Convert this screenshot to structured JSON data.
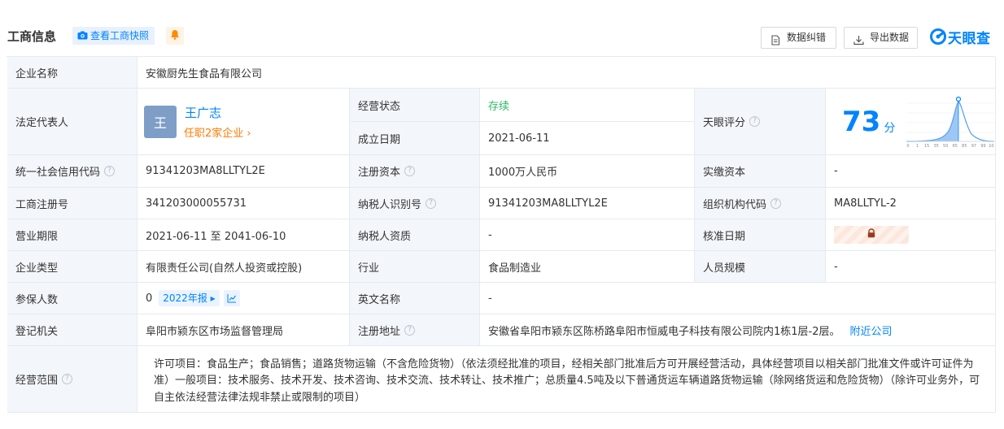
{
  "header": {
    "title": "工商信息",
    "snapshot_btn": "查看工商快照",
    "correct_btn": "数据纠错",
    "export_btn": "导出数据",
    "logo": "天眼查"
  },
  "colors": {
    "accent": "#0084ff",
    "status_green": "#2fb866",
    "orange": "#ff7a00",
    "label_bg": "#f3f6fb",
    "border": "#e4eaf2"
  },
  "fields": {
    "company_name_label": "企业名称",
    "company_name": "安徽厨先生食品有限公司",
    "legal_rep_label": "法定代表人",
    "legal_rep_avatar": "王",
    "legal_rep_name": "王广志",
    "legal_rep_sub": "任职2家企业",
    "status_label": "经营状态",
    "status": "存续",
    "established_label": "成立日期",
    "established": "2021-06-11",
    "score_label": "天眼评分",
    "score": "73",
    "score_unit": "分",
    "score_axis": [
      "0",
      "1",
      "15",
      "35",
      "50",
      "65",
      "85",
      "97",
      "99",
      "100"
    ],
    "credit_code_label": "统一社会信用代码",
    "credit_code": "91341203MA8LLTYL2E",
    "reg_capital_label": "注册资本",
    "reg_capital": "1000万人民币",
    "paid_capital_label": "实缴资本",
    "paid_capital": "-",
    "reg_no_label": "工商注册号",
    "reg_no": "341203000055731",
    "taxpayer_id_label": "纳税人识别号",
    "taxpayer_id": "91341203MA8LLTYL2E",
    "org_code_label": "组织机构代码",
    "org_code": "MA8LLTYL-2",
    "term_label": "营业期限",
    "term": "2021-06-11 至 2041-06-10",
    "taxpayer_qual_label": "纳税人资质",
    "taxpayer_qual": "-",
    "approval_date_label": "核准日期",
    "type_label": "企业类型",
    "type": "有限责任公司(自然人投资或控股)",
    "industry_label": "行业",
    "industry": "食品制造业",
    "staff_size_label": "人员规模",
    "staff_size": "-",
    "insured_label": "参保人数",
    "insured": "0",
    "insured_year": "2022年报",
    "english_name_label": "英文名称",
    "english_name": "-",
    "authority_label": "登记机关",
    "authority": "阜阳市颍东区市场监督管理局",
    "address_label": "注册地址",
    "address": "安徽省阜阳市颍东区陈桥路阜阳市恒威电子科技有限公司院内1栋1层-2层。",
    "nearby": "附近公司",
    "scope_label": "经营范围",
    "scope": "许可项目：食品生产；食品销售；道路货物运输（不含危险货物）（依法须经批准的项目，经相关部门批准后方可开展经营活动，具体经营项目以相关部门批准文件或许可证件为准）一般项目：技术服务、技术开发、技术咨询、技术交流、技术转让、技术推广；总质量4.5吨及以下普通货运车辆道路货物运输（除网络货运和危险货物）（除许可业务外，可自主依法经营法律法规非禁止或限制的项目）"
  }
}
